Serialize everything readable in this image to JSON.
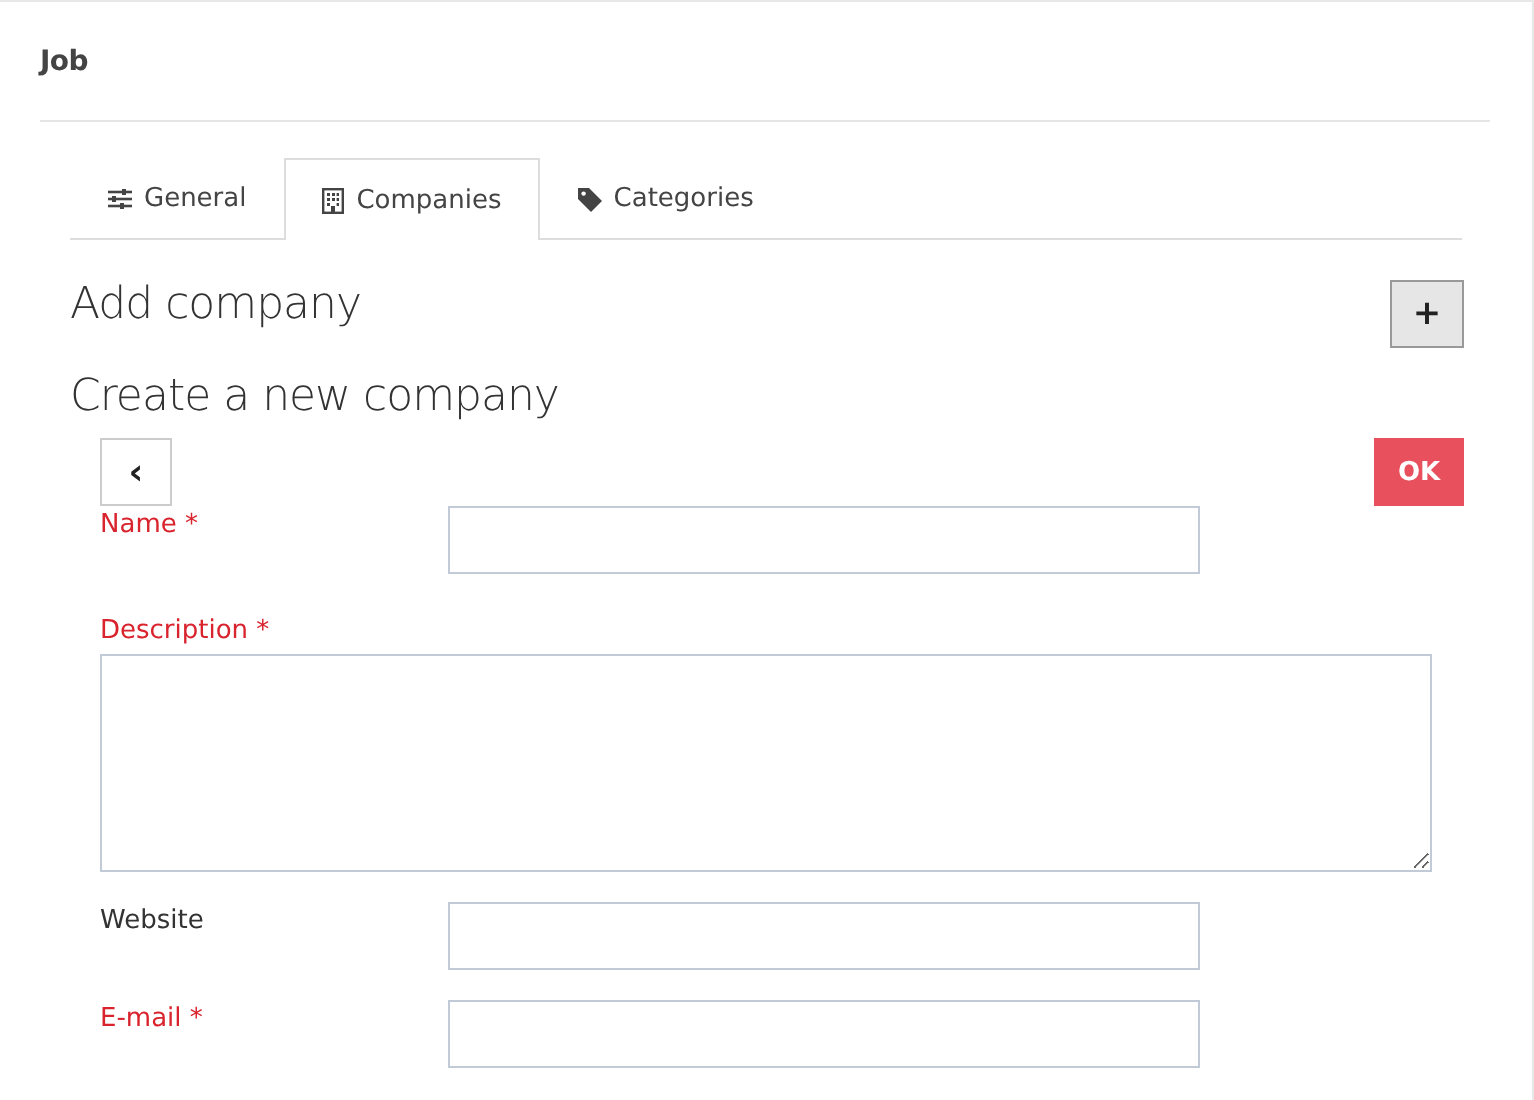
{
  "panel": {
    "title": "Job"
  },
  "tabs": [
    {
      "label": "General",
      "selected": false
    },
    {
      "label": "Companies",
      "selected": true
    },
    {
      "label": "Categories",
      "selected": false
    }
  ],
  "section": {
    "title": "Add company",
    "add_button": "+"
  },
  "form": {
    "title": "Create a new company",
    "back_button": "‹",
    "ok_button": "OK",
    "fields": [
      {
        "kind": "input",
        "label": "Name *",
        "required": true
      },
      {
        "kind": "textarea",
        "label": "Description *",
        "required": true
      },
      {
        "kind": "input",
        "label": "Website",
        "required": false
      },
      {
        "kind": "input",
        "label": "E-mail *",
        "required": true
      }
    ]
  }
}
